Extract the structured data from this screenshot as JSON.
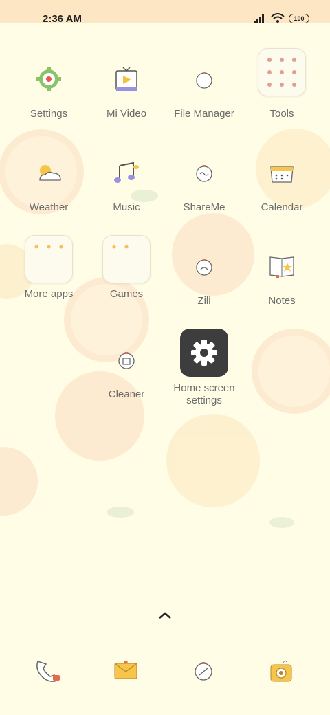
{
  "status": {
    "time": "2:36 AM",
    "battery": "100"
  },
  "apps": [
    {
      "label": "Settings",
      "icon": "settings-icon"
    },
    {
      "label": "Mi Video",
      "icon": "video-icon"
    },
    {
      "label": "File Manager",
      "icon": "file-manager-icon"
    },
    {
      "label": "Tools",
      "icon": "folder-icon"
    },
    {
      "label": "Weather",
      "icon": "weather-icon"
    },
    {
      "label": "Music",
      "icon": "music-icon"
    },
    {
      "label": "ShareMe",
      "icon": "shareme-icon"
    },
    {
      "label": "Calendar",
      "icon": "calendar-icon"
    },
    {
      "label": "More apps",
      "icon": "folder-icon"
    },
    {
      "label": "Games",
      "icon": "folder-icon"
    },
    {
      "label": "Zili",
      "icon": "zili-icon"
    },
    {
      "label": "Notes",
      "icon": "notes-icon"
    },
    {
      "label": "Cleaner",
      "icon": "cleaner-icon"
    },
    {
      "label": "Home screen settings",
      "icon": "gear-icon"
    }
  ],
  "dock": [
    {
      "icon": "phone-icon"
    },
    {
      "icon": "messages-icon"
    },
    {
      "icon": "browser-icon"
    },
    {
      "icon": "camera-icon"
    }
  ],
  "colors": {
    "background": "#fffde6",
    "statusbar": "#fde6c3",
    "accent": "#f5c85c"
  }
}
